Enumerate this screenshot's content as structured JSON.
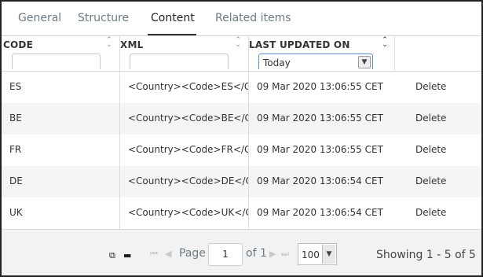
{
  "tabs": [
    {
      "label": "General"
    },
    {
      "label": "Structure"
    },
    {
      "label": "Content"
    },
    {
      "label": "Related items"
    }
  ],
  "active_tab": "Content",
  "columns": {
    "code": {
      "label": "CODE",
      "filter": ""
    },
    "xml": {
      "label": "XML",
      "filter": ""
    },
    "last_updated": {
      "label": "LAST UPDATED ON",
      "filter": "Today"
    }
  },
  "rows": [
    {
      "code": "ES",
      "xml": "<Country><Code>ES</Cou",
      "updated": "09 Mar 2020 13:06:55 CET",
      "action": "Delete"
    },
    {
      "code": "BE",
      "xml": "<Country><Code>BE</Cou",
      "updated": "09 Mar 2020 13:06:55 CET",
      "action": "Delete"
    },
    {
      "code": "FR",
      "xml": "<Country><Code>FR</Cou",
      "updated": "09 Mar 2020 13:06:55 CET",
      "action": "Delete"
    },
    {
      "code": "DE",
      "xml": "<Country><Code>DE</Cou",
      "updated": "09 Mar 2020 13:06:54 CET",
      "action": "Delete"
    },
    {
      "code": "UK",
      "xml": "<Country><Code>UK</Cou",
      "updated": "09 Mar 2020 13:06:54 CET",
      "action": "Delete"
    }
  ],
  "pager": {
    "page_label": "Page",
    "page_value": "1",
    "of_label": "of 1",
    "page_size": "100",
    "showing": "Showing 1 - 5 of 5"
  },
  "colors": {
    "row_alt": "#f5f5f5",
    "footer_bg": "#f2f2f2",
    "tab_inactive": "#6b7a85"
  }
}
